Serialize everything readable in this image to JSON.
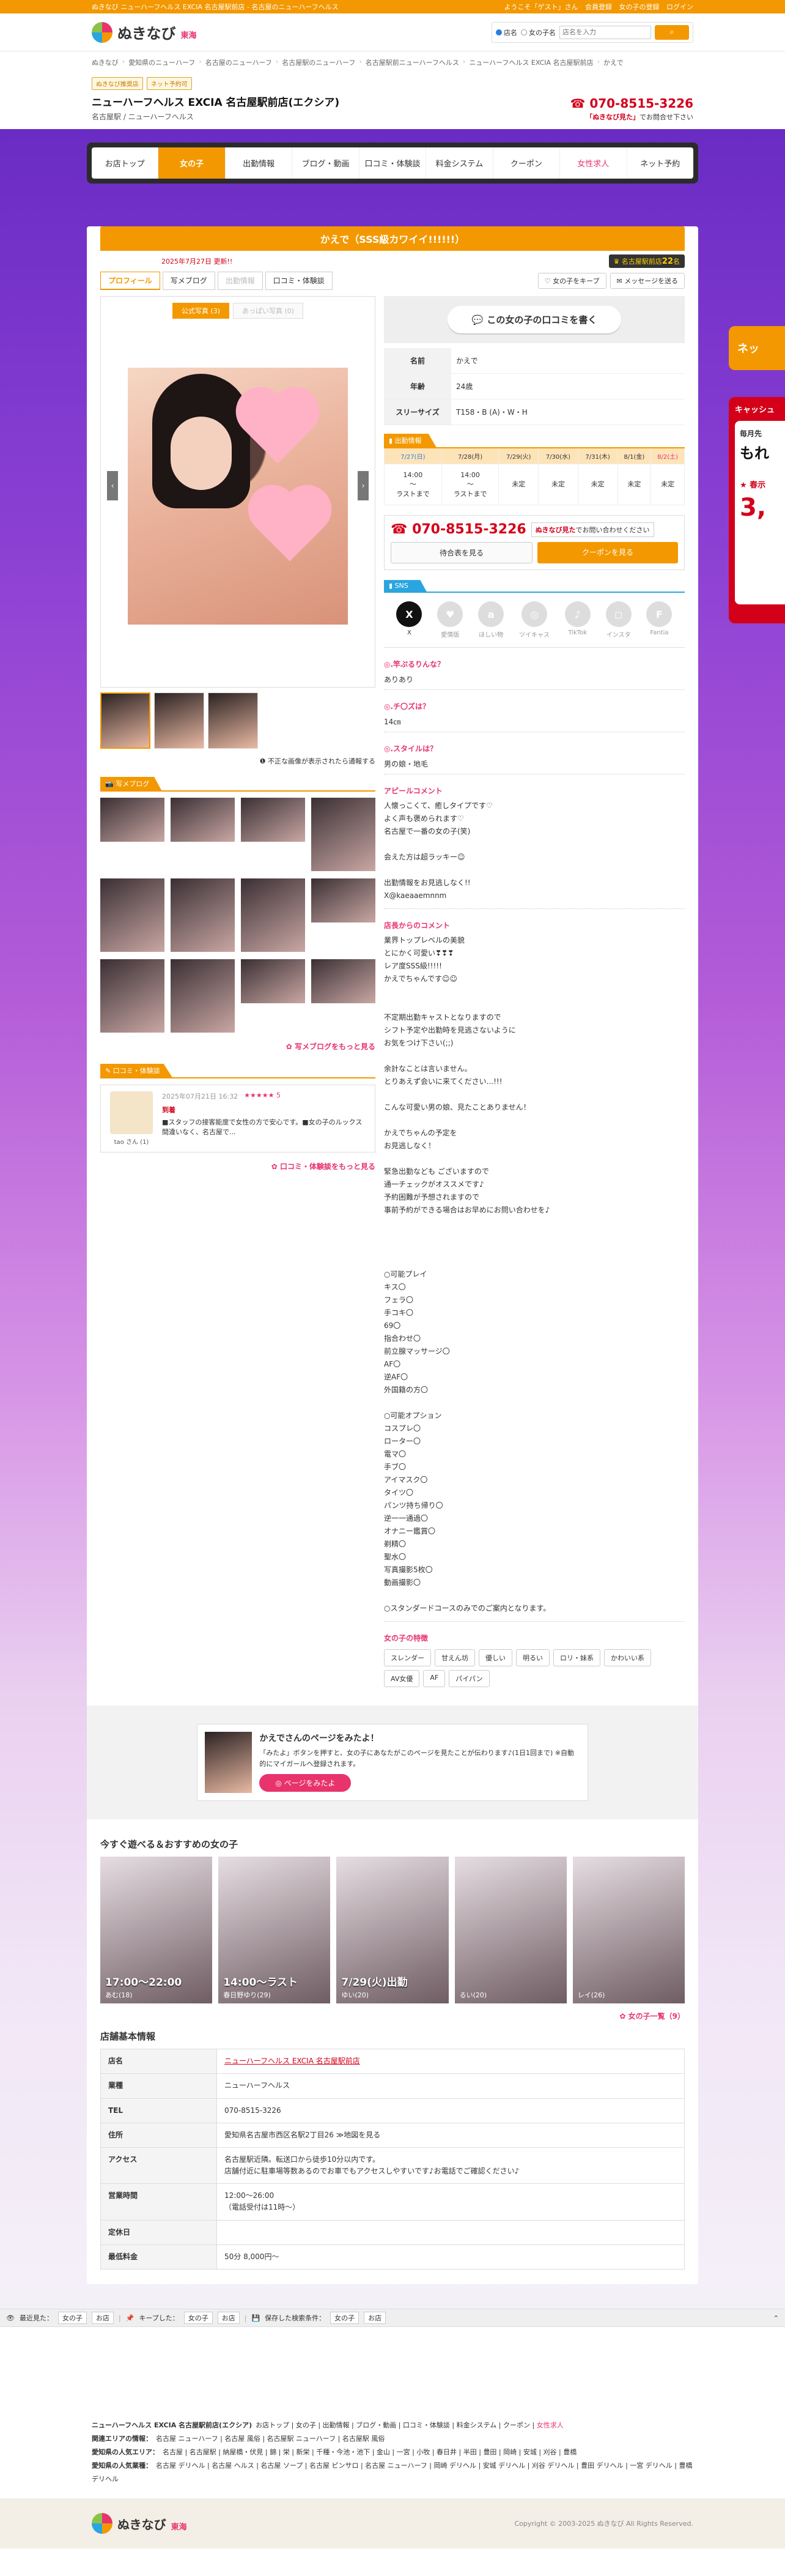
{
  "top_strip": {
    "tagline": "ぬきなび ニューハーフヘルス EXCIA 名古屋駅前店 - 名古屋のニューハーフヘルス",
    "welcome": "ようこそ「ゲスト」さん",
    "register": "会員登録",
    "favorites": "女の子の登録",
    "login": "ログイン"
  },
  "header": {
    "logo_text": "ぬきなび",
    "logo_region": "東海",
    "search_opt_shop": "店名",
    "search_opt_girl": "女の子名",
    "search_placeholder": "店名を入力",
    "search_icon": "search-icon"
  },
  "breadcrumb": [
    "ぬきなび",
    "愛知県のニューハーフ",
    "名古屋のニューハーフ",
    "名古屋駅のニューハーフ",
    "名古屋駅前ニューハーフヘルス",
    "ニューハーフヘルス EXCIA 名古屋駅前店",
    "かえで"
  ],
  "shop": {
    "badge1": "ぬきなび推奨店",
    "badge2": "ネット予約可",
    "name": "ニューハーフヘルス EXCIA 名古屋駅前店(エクシア)",
    "sub": "名古屋駅 / ニューハーフヘルス",
    "tel": "070-8515-3226",
    "tel_note_prefix": "「ぬきなび見た」",
    "tel_note_suffix": "でお問合せ下さい"
  },
  "gnav": [
    "お店トップ",
    "女の子",
    "出勤情報",
    "ブログ・動画",
    "口コミ・体験談",
    "料金システム",
    "クーポン",
    "女性求人",
    "ネット予約"
  ],
  "float": {
    "net": "ネッ",
    "cash_title": "キャッシュ",
    "cash_l1": "毎月先",
    "cash_l2": "もれ",
    "cash_l3": "★ 春示",
    "cash_l4": "3,"
  },
  "profile": {
    "title": "かえで（SSS級カワイイ!!!!!!）",
    "date": "2025年7月27日 更新!!",
    "count_badge_prefix": "名古屋駅前店",
    "count_badge_num": "22",
    "count_badge_suffix": "名",
    "tabs": [
      "プロフィール",
      "写メブログ",
      "出勤情報",
      "口コミ・体験談"
    ],
    "btn_keep": "女の子をキープ",
    "btn_message": "メッセージを送る",
    "photo_tab_official": "公式写真 (3)",
    "photo_tab_mine": "あっぱい写真 (0)",
    "report": "不正な画像が表示されたら通報する"
  },
  "blog": {
    "label": "写メブログ",
    "more": "写メブログをもっと見る"
  },
  "reviews": {
    "label": "口コミ・体験談",
    "date": "2025年07月21日 16:32",
    "stars": "★★★★★ 5",
    "user": "tao さん (1)",
    "tag": "到着",
    "text": "■スタッフの接客能度で女性の方で安心です。■女の子のルックス間違いなく、名古屋で...",
    "more": "口コミ・体験談をもっと見る"
  },
  "right": {
    "review_cta": "この女の子の口コミを書く",
    "info": [
      {
        "k": "名前",
        "v": "かえで"
      },
      {
        "k": "年齢",
        "v": "24歳"
      },
      {
        "k": "スリーサイズ",
        "v": "T158・B (A)・W・H"
      }
    ],
    "schedule_label": "出勤情報",
    "schedule": [
      {
        "d": "7/27(日)",
        "t": "14:00\n～\nラストまで",
        "cls": "sun"
      },
      {
        "d": "7/28(月)",
        "t": "14:00\n～\nラストまで",
        "cls": ""
      },
      {
        "d": "7/29(火)",
        "t": "未定",
        "cls": ""
      },
      {
        "d": "7/30(水)",
        "t": "未定",
        "cls": ""
      },
      {
        "d": "7/31(木)",
        "t": "未定",
        "cls": ""
      },
      {
        "d": "8/1(金)",
        "t": "未定",
        "cls": ""
      },
      {
        "d": "8/2(土)",
        "t": "未定",
        "cls": "sat"
      }
    ],
    "tel": "070-8515-3226",
    "tel_note": "ぬきなび見た",
    "tel_note_suffix": "でお問い合わせください",
    "btn_sched": "待合表を見る",
    "btn_coupon": "クーポンを見る",
    "sns_label": "SNS",
    "sns": [
      {
        "n": "X",
        "g": "X",
        "cls": "x"
      },
      {
        "n": "愛情版",
        "g": "♥",
        "cls": ""
      },
      {
        "n": "ほしい物",
        "g": "a",
        "cls": ""
      },
      {
        "n": "ツイキャス",
        "g": "◎",
        "cls": ""
      },
      {
        "n": "TikTok",
        "g": "♪",
        "cls": ""
      },
      {
        "n": "インスタ",
        "g": "◻",
        "cls": ""
      },
      {
        "n": "Fantia",
        "g": "F",
        "cls": ""
      }
    ],
    "qa": [
      {
        "q": "◎.竿ぷるりんな？",
        "a": "ありあり"
      },
      {
        "q": "◎.チ〇ズは？",
        "a": "14㎝"
      },
      {
        "q": "◎.スタイルは？",
        "a": "男の娘・地毛"
      }
    ],
    "appeal_title": "アピールコメント",
    "appeal": "人懐っこくて、癒しタイプです♡\nよく声も褒められます♡\n名古屋で一番の女の子(笑)\n\n会えた方は超ラッキー☺\n\n出勤情報をお見逃しなく!!\nX@kaeaaemnnm",
    "shop_comment_title": "店長からのコメント",
    "shop_comment": "業界トップレベルの美貌\nとにかく可愛い❣❣❣\nレア度SSS級!!!!!\nかえでちゃんです☺☺\n\n\n不定期出勤キャストとなりますので\nシフト予定や出勤時を見逃さないように\nお気をつけ下さい(;;)\n\n余計なことは言いません。\nとりあえず会いに来てください...!!!\n\nこんな可愛い男の娘、見たことありません！\n\nかえでちゃんの予定を\nお見逃しなく！\n\n緊急出勤なども ございますので\n通一チェックがオススメです♪\n予約困難が予想されますので\n事前予約ができる場合はお早めにお問い合わせを♪\n\n\n\n\n○可能プレイ\nキス〇\nフェラ〇\n手コキ〇\n69〇\n指合わせ〇\n前立腺マッサージ〇\nAF〇\n逆AF〇\n外国籍の方〇\n\n○可能オプション\nコスプレ〇\nローター〇\n電マ〇\n手ブ〇\nアイマスク〇\nタイツ〇\nパンツ持ち帰り〇\n逆一一通過〇\nオナニー鑑賞〇\n剃精〇\n聖水〇\n写真撮影5枚〇\n動画撮影〇\n\n○スタンダードコースのみでのご案内となります。",
    "traits_title": "女の子の特徴",
    "traits": [
      "スレンダー",
      "甘えん坊",
      "優しい",
      "明るい",
      "ロリ・妹系",
      "かわいい系",
      "AV女優",
      "AF",
      "パイパン"
    ]
  },
  "promo": {
    "title": "かえでさんのページをみたよ！",
    "text": "「みたよ」ボタンを押すと、女の子にあなたがこのページを見たことが伝わります♪(1日1回まで) ※自動的にマイガールへ登録されます。",
    "btn": "ページをみたよ"
  },
  "recommended": {
    "title": "今すぐ遊べる＆おすすめの女の子",
    "cards": [
      {
        "t": "17:00～22:00",
        "n": "あむ(18)"
      },
      {
        "t": "14:00～ラスト",
        "n": "春日野ゆり(29)"
      },
      {
        "t": "7/29(火)出勤",
        "n": "ゆい(20)"
      },
      {
        "t": "",
        "n": "るい(20)"
      },
      {
        "t": "",
        "n": "レイ(26)"
      }
    ],
    "more": "女の子一覧（9）"
  },
  "shop_info": {
    "title": "店舗基本情報",
    "rows": [
      {
        "k": "店名",
        "v": "ニューハーフヘルス EXCIA 名古屋駅前店",
        "link": true
      },
      {
        "k": "業種",
        "v": "ニューハーフヘルス",
        "link": false
      },
      {
        "k": "TEL",
        "v": "070-8515-3226",
        "link": false
      },
      {
        "k": "住所",
        "v": "愛知県名古屋市西区名駅2丁目26 ≫地図を見る",
        "link": false
      },
      {
        "k": "アクセス",
        "v": "名古屋駅近隣。転送口から徒歩10分以内です。\n店舗付近に駐車場等数あるのでお車でもアクセスしやすいです♪お電話でご確認ください♪",
        "link": false
      },
      {
        "k": "営業時間",
        "v": "12:00～26:00\n（電話受付は11時～）",
        "link": false
      },
      {
        "k": "定休日",
        "v": "",
        "link": false
      },
      {
        "k": "最低料金",
        "v": "50分 8,000円～",
        "link": false
      }
    ]
  },
  "history": {
    "recent_label": "最近見た：",
    "recent_girl": "女の子",
    "recent_shop": "お店",
    "kept_label": "キープした：",
    "kept_girl": "女の子",
    "kept_shop": "お店",
    "saved_label": "保存した検索条件：",
    "saved_girl": "女の子",
    "saved_shop": "お店"
  },
  "footer": {
    "row1_title": "ニューハーフヘルス EXCIA 名古屋駅前店(エクシア)",
    "row1_links": [
      "お店トップ",
      "女の子",
      "出勤情報",
      "ブログ・動画",
      "口コミ・体験談",
      "料金システム",
      "クーポン",
      "女性求人"
    ],
    "row2_title": "関連エリアの情報：",
    "row2_links": [
      "名古屋 ニューハーフ",
      "名古屋 風俗",
      "名古屋駅 ニューハーフ",
      "名古屋駅 風俗"
    ],
    "row3_title": "愛知県の人気エリア：",
    "row3_links": [
      "名古屋",
      "名古屋駅",
      "納屋橋・伏見",
      "錦",
      "栄",
      "新栄",
      "千種・今池・池下",
      "金山",
      "一宮",
      "小牧",
      "春日井",
      "半田",
      "豊田",
      "岡崎",
      "安城",
      "刈谷",
      "豊橋"
    ],
    "row4_title": "愛知県の人気業種：",
    "row4_links": [
      "名古屋 デリヘル",
      "名古屋 ヘルス",
      "名古屋 ソープ",
      "名古屋 ピンサロ",
      "名古屋 ニューハーフ",
      "岡崎 デリヘル",
      "安城 デリヘル",
      "刈谷 デリヘル",
      "豊田 デリヘル",
      "一宮 デリヘル",
      "豊橋 デリヘル"
    ],
    "copyright": "Copyright © 2003-2025 ぬきなび All Rights Reserved."
  }
}
